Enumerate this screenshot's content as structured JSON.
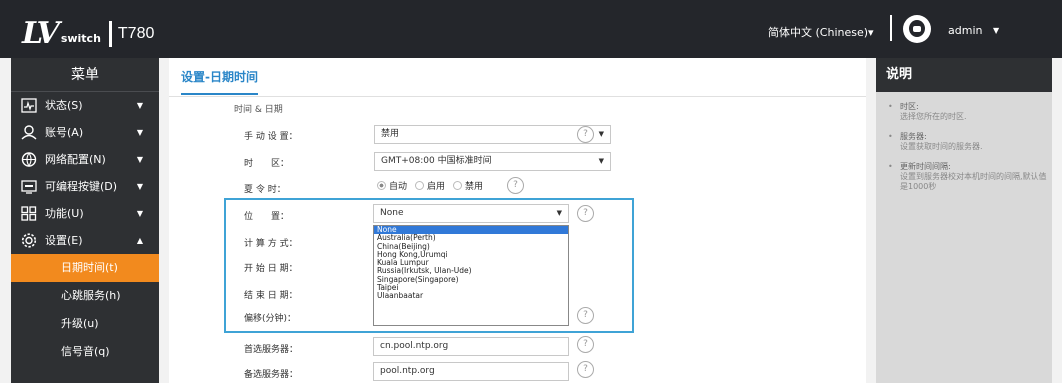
{
  "header": {
    "logo_mark": "LV",
    "logo_switch": "switch",
    "model": "T780",
    "language": "简体中文 (Chinese)",
    "language_caret": "▾",
    "user": "admin",
    "user_caret": "▼"
  },
  "sidebar": {
    "title": "菜单",
    "items": [
      {
        "label": "状态(S)",
        "icon": "status-icon",
        "arrow": "▼"
      },
      {
        "label": "账号(A)",
        "icon": "account-icon",
        "arrow": "▼"
      },
      {
        "label": "网络配置(N)",
        "icon": "network-icon",
        "arrow": "▼"
      },
      {
        "label": "可编程按键(D)",
        "icon": "keyboard-icon",
        "arrow": "▼"
      },
      {
        "label": "功能(U)",
        "icon": "features-icon",
        "arrow": "▼"
      },
      {
        "label": "设置(E)",
        "icon": "settings-icon",
        "arrow": "▲"
      }
    ],
    "subitems": [
      {
        "label": "日期时间(t)",
        "active": true
      },
      {
        "label": "心跳服务(h)",
        "active": false
      },
      {
        "label": "升级(u)",
        "active": false
      },
      {
        "label": "信号音(q)",
        "active": false
      }
    ]
  },
  "main": {
    "tab": "设置-日期时间",
    "section": "时间 & 日期",
    "rows": {
      "manual_label": "手 动 设 置：",
      "manual_value": "禁用",
      "timezone_label": "时　　区：",
      "timezone_value": "GMT+08:00 中国标准时间",
      "dst_label": "夏 令 时：",
      "dst_options": [
        "自动",
        "启用",
        "禁用"
      ],
      "location_label": "位　　置：",
      "location_value": "None",
      "calc_label": "计 算 方 式：",
      "start_label": "开 始 日 期：",
      "end_label": "结 束 日 期：",
      "offset_label": "偏移(分钟)：",
      "primary_server_label": "首选服务器：",
      "primary_server_value": "cn.pool.ntp.org",
      "secondary_server_label": "备选服务器：",
      "secondary_server_value": "pool.ntp.org"
    },
    "help_symbol": "?",
    "dropdown_options": [
      "None",
      "Australia(Perth)",
      "China(Beijing)",
      "Hong Kong,Urumqi",
      "Kuala Lumpur",
      "Russia(Irkutsk, Ulan-Ude)",
      "Singapore(Singapore)",
      "Taipei",
      "Ulaanbaatar"
    ]
  },
  "right_panel": {
    "title": "说明",
    "items": [
      {
        "title": "时区:",
        "desc": "选择您所在的时区."
      },
      {
        "title": "服务器:",
        "desc": "设置获取时间的服务器."
      },
      {
        "title": "更新时间间隔:",
        "desc": "设置到服务器校对本机时间的间隔,默认值是1000秒"
      }
    ]
  },
  "colors": {
    "header_bg": "#24262b",
    "sidebar_bg": "#2e3033",
    "active_item": "#f28a1e",
    "accent_blue": "#2a86c8",
    "highlight_border": "#3fa3d6",
    "dropdown_selected": "#3179d8"
  }
}
